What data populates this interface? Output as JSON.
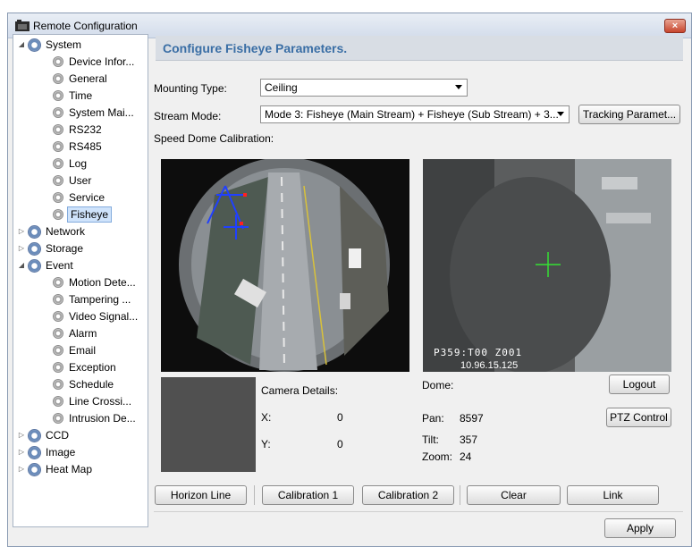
{
  "window": {
    "title": "Remote Configuration",
    "close_label": "×"
  },
  "tree": {
    "system": "System",
    "system_items": [
      "Device Infor...",
      "General",
      "Time",
      "System Mai...",
      "RS232",
      "RS485",
      "Log",
      "User",
      "Service",
      "Fisheye"
    ],
    "network": "Network",
    "storage": "Storage",
    "event": "Event",
    "event_items": [
      "Motion Dete...",
      "Tampering ...",
      "Video Signal...",
      "Alarm",
      "Email",
      "Exception",
      "Schedule",
      "Line Crossi...",
      "Intrusion De..."
    ],
    "ccd": "CCD",
    "image": "Image",
    "heat_map": "Heat Map"
  },
  "header": {
    "title": "Configure Fisheye Parameters."
  },
  "form": {
    "mounting_type_label": "Mounting Type:",
    "mounting_type_value": "Ceiling",
    "stream_mode_label": "Stream Mode:",
    "stream_mode_value": "Mode 3: Fisheye (Main Stream) + Fisheye (Sub Stream) + 3...",
    "tracking_button": "Tracking Paramet...",
    "calibration_label": "Speed Dome Calibration:"
  },
  "dome_overlay": {
    "code": "P359:T00  Z001",
    "ip": "10.96.15.125"
  },
  "camera": {
    "label": "Camera Details:",
    "x_label": "X:",
    "x_value": "0",
    "y_label": "Y:",
    "y_value": "0"
  },
  "dome": {
    "label": "Dome:",
    "pan_label": "Pan:",
    "pan_value": "8597",
    "tilt_label": "Tilt:",
    "tilt_value": "357",
    "zoom_label": "Zoom:",
    "zoom_value": "24",
    "logout_button": "Logout",
    "ptz_button": "PTZ Control"
  },
  "buttons": {
    "horizon": "Horizon Line",
    "calibration1": "Calibration 1",
    "calibration2": "Calibration 2",
    "clear": "Clear",
    "link": "Link",
    "apply": "Apply"
  }
}
